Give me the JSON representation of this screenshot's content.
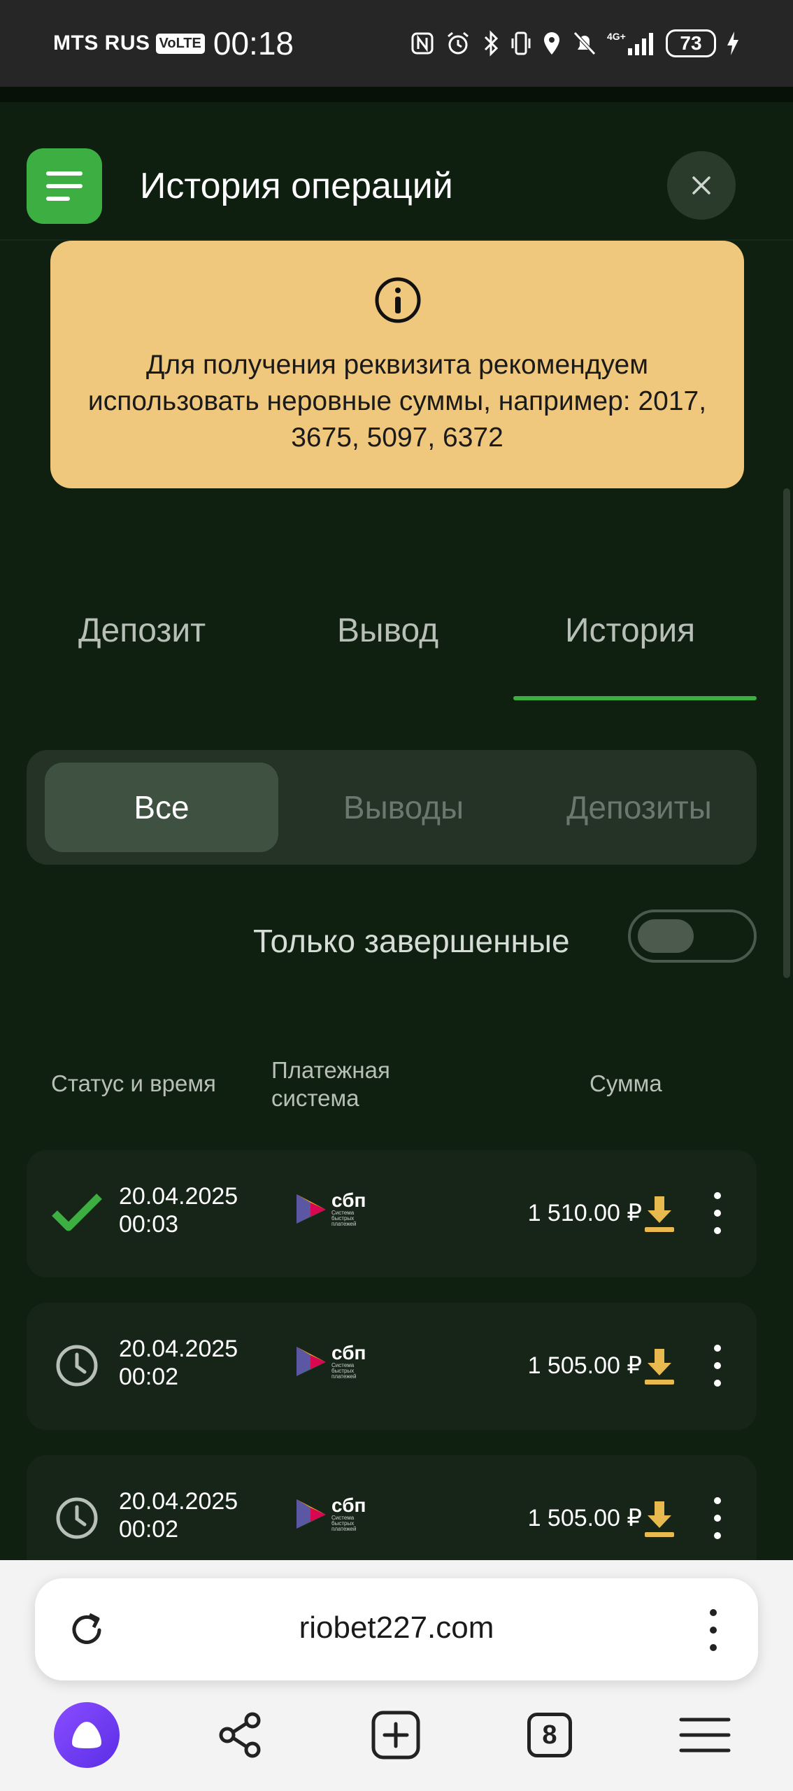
{
  "status_bar": {
    "carrier": "MTS RUS",
    "volte": "VoLTE",
    "time": "00:18",
    "network": "4G+",
    "battery": "73"
  },
  "header": {
    "title": "История операций"
  },
  "notice": {
    "text": "Для получения реквизита рекомендуем использовать неровные суммы, например: 2017, 3675, 5097, 6372"
  },
  "tabs": [
    {
      "label": "Депозит",
      "active": false
    },
    {
      "label": "Вывод",
      "active": false
    },
    {
      "label": "История",
      "active": true
    }
  ],
  "filter": {
    "segments": [
      {
        "label": "Все",
        "active": true
      },
      {
        "label": "Выводы",
        "active": false
      },
      {
        "label": "Депозиты",
        "active": false
      }
    ],
    "only_completed_label": "Только завершенные",
    "only_completed": false
  },
  "table": {
    "columns": {
      "status_time": "Статус и время",
      "payment_system": "Платежная система",
      "amount": "Сумма"
    },
    "rows": [
      {
        "status": "completed",
        "date": "20.04.2025",
        "time": "00:03",
        "system": "сбп",
        "system_sub": "Система быстрых платежей",
        "amount": "1 510.00 ₽"
      },
      {
        "status": "pending",
        "date": "20.04.2025",
        "time": "00:02",
        "system": "сбп",
        "system_sub": "Система быстрых платежей",
        "amount": "1 505.00 ₽"
      },
      {
        "status": "pending",
        "date": "20.04.2025",
        "time": "00:02",
        "system": "сбп",
        "system_sub": "Система быстрых платежей",
        "amount": "1 505.00 ₽"
      }
    ]
  },
  "browser": {
    "url": "riobet227.com",
    "tabs_count": "8"
  },
  "colors": {
    "accent_green": "#3dae42",
    "notice_bg": "#efc77d",
    "download_icon": "#e8b94f",
    "background": "#0f1f10"
  },
  "icons": [
    "menu-icon",
    "close-icon",
    "info-icon",
    "check-icon",
    "clock-icon",
    "download-icon",
    "more-vert-icon",
    "reload-icon",
    "alice-icon",
    "share-icon",
    "new-tab-icon",
    "tabs-icon",
    "hamburger-icon"
  ]
}
